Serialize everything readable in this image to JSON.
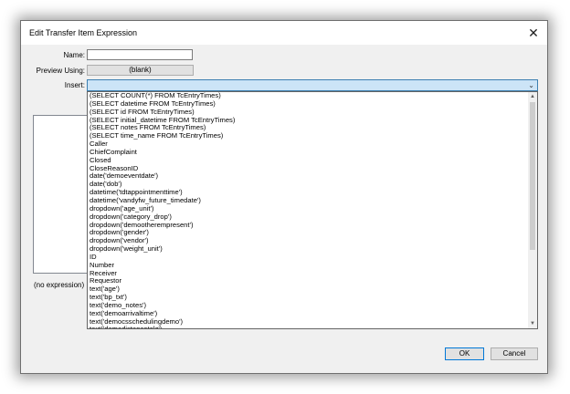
{
  "window": {
    "title": "Edit Transfer Item Expression",
    "close_glyph": "✕"
  },
  "form": {
    "name_label": "Name:",
    "name_value": "",
    "preview_label": "Preview Using:",
    "preview_value": "(blank)",
    "insert_label": "Insert:",
    "insert_value": ""
  },
  "expression": {
    "status": "(no expression)"
  },
  "insert_options": [
    "(SELECT COUNT(*) FROM TcEntryTimes)",
    "(SELECT datetime FROM TcEntryTimes)",
    "(SELECT id FROM TcEntryTimes)",
    "(SELECT initial_datetime FROM TcEntryTimes)",
    "(SELECT notes FROM TcEntryTimes)",
    "(SELECT time_name FROM TcEntryTimes)",
    "Caller",
    "ChiefComplaint",
    "Closed",
    "CloseReasonID",
    "date('demoeventdate')",
    "date('dob')",
    "datetime('tdtappointmenttime')",
    "datetime('vandyfw_future_timedate')",
    "dropdown('age_unit')",
    "dropdown('category_drop')",
    "dropdown('demootherempresent')",
    "dropdown('gender')",
    "dropdown('vendor')",
    "dropdown('weight_unit')",
    "ID",
    "Number",
    "Receiver",
    "Requestor",
    "text('age')",
    "text('bp_txt')",
    "text('demo_notes')",
    "text('demoarrivaltime')",
    "text('democsschedulingdemo')",
    "text('demodistancetolz')"
  ],
  "buttons": {
    "ok": "OK",
    "cancel": "Cancel"
  },
  "icons": {
    "dropdown_arrow": "⌄",
    "scroll_up": "▲",
    "scroll_down": "▼"
  }
}
